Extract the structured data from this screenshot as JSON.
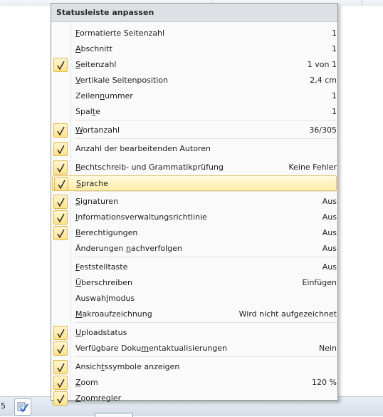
{
  "menu": {
    "title": "Statusleiste anpassen",
    "items": [
      {
        "pre": "",
        "key": "F",
        "post": "ormatierte Seitenzahl",
        "value": "1",
        "checked": false
      },
      {
        "pre": "",
        "key": "A",
        "post": "bschnitt",
        "value": "1",
        "checked": false
      },
      {
        "pre": "",
        "key": "S",
        "post": "eitenzahl",
        "value": "1 von 1",
        "checked": true
      },
      {
        "pre": "",
        "key": "V",
        "post": "ertikale Seitenposition",
        "value": "2,4 cm",
        "checked": false
      },
      {
        "pre": "Zeilen",
        "key": "n",
        "post": "ummer",
        "value": "1",
        "checked": false
      },
      {
        "pre": "Spal",
        "key": "t",
        "post": "e",
        "value": "1",
        "checked": false
      },
      {
        "pre": "",
        "key": "W",
        "post": "ortanzahl",
        "value": "36/305",
        "checked": true
      },
      {
        "pre": "Anzahl der bearbeitenden Autoren",
        "key": "",
        "post": "",
        "value": "",
        "checked": true
      },
      {
        "pre": "",
        "key": "R",
        "post": "echtschreib- und Grammatikprüfung",
        "value": "Keine Fehler",
        "checked": true
      },
      {
        "pre": "",
        "key": "S",
        "post": "prache",
        "value": "",
        "checked": true,
        "highlighted": true
      },
      {
        "pre": "",
        "key": "S",
        "post": "ignaturen",
        "value": "Aus",
        "checked": true
      },
      {
        "pre": "",
        "key": "I",
        "post": "nformationsverwaltungsrichtlinie",
        "value": "Aus",
        "checked": true
      },
      {
        "pre": "",
        "key": "B",
        "post": "erechtigungen",
        "value": "Aus",
        "checked": true
      },
      {
        "pre": "Änderungen ",
        "key": "n",
        "post": "achverfolgen",
        "value": "Aus",
        "checked": false
      },
      {
        "pre": "",
        "key": "F",
        "post": "eststelltaste",
        "value": "Aus",
        "checked": false
      },
      {
        "pre": "",
        "key": "Ü",
        "post": "berschreiben",
        "value": "Einfügen",
        "checked": false
      },
      {
        "pre": "Auswah",
        "key": "l",
        "post": "modus",
        "value": "",
        "checked": false
      },
      {
        "pre": "",
        "key": "M",
        "post": "akroaufzeichnung",
        "value": "Wird nicht aufgezeichnet",
        "checked": false
      },
      {
        "pre": "",
        "key": "U",
        "post": "ploadstatus",
        "value": "",
        "checked": true
      },
      {
        "pre": "Verfügbare Doku",
        "key": "m",
        "post": "entaktualisierungen",
        "value": "Nein",
        "checked": true
      },
      {
        "pre": "Ansich",
        "key": "t",
        "post": "ssymbole anzeigen",
        "value": "",
        "checked": true
      },
      {
        "pre": "",
        "key": "Z",
        "post": "oom",
        "value": "120 %",
        "checked": true
      },
      {
        "pre": "",
        "key": "Z",
        "post": "oomregler",
        "value": "",
        "checked": true
      }
    ]
  },
  "statusbar": {
    "page_number": "5"
  },
  "icons": {
    "check": "checkmark-icon",
    "proofing": "proofing-check-icon"
  },
  "colors": {
    "highlight": "#ffeea8",
    "check_bg": "#ffe28a",
    "title_bg": "#dde1e6"
  }
}
